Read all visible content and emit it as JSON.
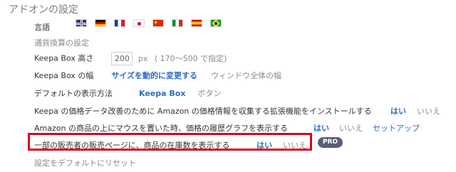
{
  "settings": {
    "title": "アドオンの設定",
    "language_label": "言語",
    "flags": [
      "uk-flag-icon",
      "de-flag-icon",
      "fr-flag-icon",
      "jp-flag-icon",
      "cn-flag-icon",
      "it-flag-icon",
      "es-flag-icon",
      "br-flag-icon"
    ],
    "currency_label": "通貨換算の設定",
    "box_height": {
      "label": "Keepa Box 高さ",
      "value": "200",
      "unit": "px",
      "hint": "( 170〜500 で指定)"
    },
    "box_width": {
      "label": "Keepa Box の幅",
      "option_dynamic": "サイズを動的に変更する",
      "option_window": "ウィンドウ全体の幅"
    },
    "default_display": {
      "label": "デフォルトの表示方法",
      "option_box": "Keepa Box",
      "option_button": "ボタン"
    },
    "price_data_ext": {
      "label": "Keepa の価格データ改善のために Amazon の価格情報を収集する拡張機能をインストールする",
      "yes": "はい",
      "no": "いいえ"
    },
    "hover_graph": {
      "label": "Amazon の商品の上にマウスを置いた時、価格の履歴グラフを表示する",
      "yes": "はい",
      "no": "いいえ",
      "setup": "セットアップ"
    },
    "seller_stock": {
      "label": "一部の販売者の販売ページに、商品の在庫数を表示する",
      "yes": "はい",
      "no": "いいえ",
      "badge": "PRO"
    },
    "reset_label": "設定をデフォルトにリセット"
  }
}
